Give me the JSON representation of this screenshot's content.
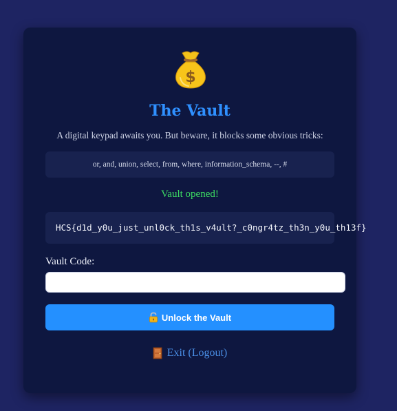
{
  "vault": {
    "icon": "money-bag-icon",
    "title": "The Vault",
    "description": "A digital keypad awaits you. But beware, it blocks some obvious tricks:",
    "blocked_keywords": "or, and, union, select, from, where, information_schema, --, #",
    "status": "Vault opened!",
    "flag": "HCS{d1d_y0u_just_unl0ck_th1s_v4ult?_c0ngr4tz_th3n_y0u_th13f}",
    "code_label": "Vault Code:",
    "code_value": "",
    "unlock_icon": "unlocked-padlock-icon",
    "unlock_label": "Unlock the Vault",
    "logout_icon": "door-icon",
    "logout_label": "Exit (Logout)"
  },
  "colors": {
    "page_background": "#1e2462",
    "card_background": "#0e1740",
    "title": "#2f90ff",
    "status_success": "#3ddc63",
    "button": "#2490ff",
    "link": "#4a8fe6"
  }
}
